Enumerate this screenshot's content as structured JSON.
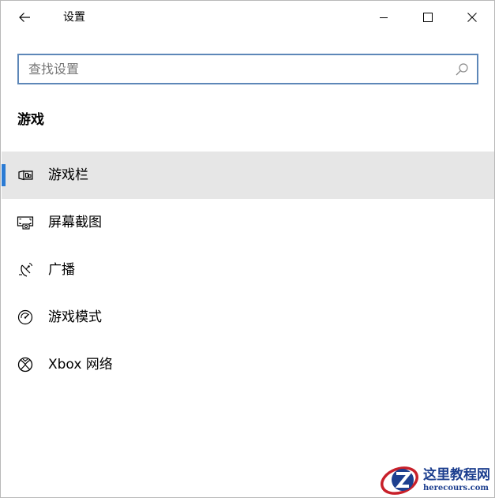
{
  "window": {
    "title": "设置",
    "controls": {
      "back": "back-arrow-icon",
      "minimize": "minimize-icon",
      "maximize": "maximize-icon",
      "close": "close-icon"
    }
  },
  "search": {
    "value": "",
    "placeholder": "查找设置",
    "icon": "search-icon",
    "border_color": "#5d87b8"
  },
  "section": {
    "title": "游戏"
  },
  "nav": {
    "selected_index": 0,
    "accent_color": "#2b7bd4",
    "selected_bg": "#e6e6e6",
    "items": [
      {
        "label": "游戏栏",
        "icon": "game-bar-icon"
      },
      {
        "label": "屏幕截图",
        "icon": "screenshot-icon"
      },
      {
        "label": "广播",
        "icon": "broadcast-icon"
      },
      {
        "label": "游戏模式",
        "icon": "game-mode-icon"
      },
      {
        "label": "Xbox 网络",
        "icon": "xbox-icon"
      }
    ]
  },
  "watermark": {
    "title": "这里教程网",
    "url": "herecours.com",
    "logo": "z-logo"
  }
}
